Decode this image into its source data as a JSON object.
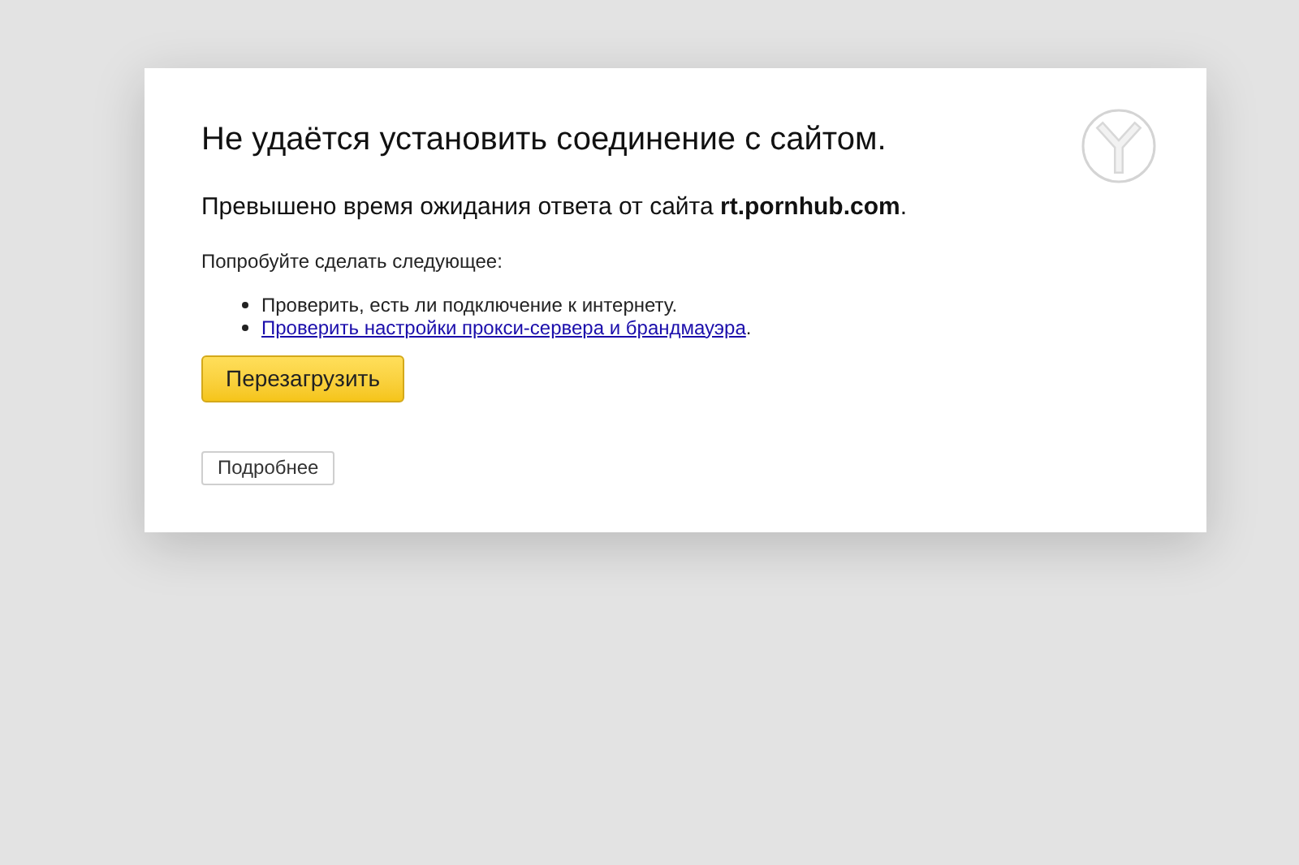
{
  "error_page": {
    "title": "Не удаётся установить соединение с сайтом.",
    "message": "Превышено время ожидания ответа от сайта **rt.pornhub.com**.",
    "suggestions_heading": "Попробуйте сделать следующее:",
    "suggestions": [
      {
        "kind": "text",
        "text": "Проверить, есть ли подключение к интернету."
      },
      {
        "kind": "link",
        "text": "Проверить настройки прокси-сервера и брандмауэра",
        "after": "."
      }
    ],
    "reload_button": "Перезагрузить",
    "details_button": "Подробнее"
  }
}
